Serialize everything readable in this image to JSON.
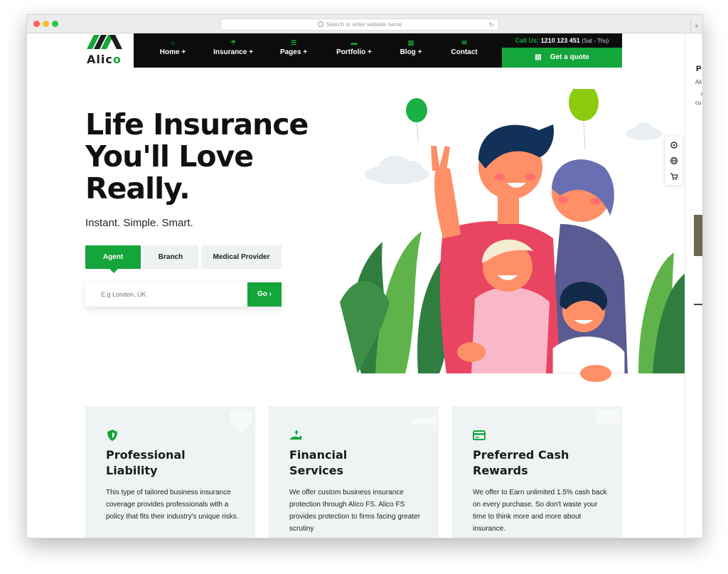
{
  "browser": {
    "address_placeholder": "Search or enter website name",
    "colors": {
      "close": "#ff5f57",
      "minimize": "#febc2e",
      "maximize": "#28c840"
    }
  },
  "brand": {
    "name_main": "Alic",
    "name_accent": "o",
    "accent_color": "#14a53b"
  },
  "nav": {
    "items": [
      {
        "label": "Home +",
        "icon": "home-icon"
      },
      {
        "label": "Insurance +",
        "icon": "umbrella-icon"
      },
      {
        "label": "Pages +",
        "icon": "menu-icon"
      },
      {
        "label": "Portfolio +",
        "icon": "briefcase-icon"
      },
      {
        "label": "Blog +",
        "icon": "document-icon"
      },
      {
        "label": "Contact",
        "icon": "envelope-icon"
      }
    ],
    "call_label": "Call Us:",
    "call_number": "1210 123 451",
    "call_hours": "(Sat - Thu)",
    "quote_label": "Get a quote"
  },
  "hero": {
    "title": "Life Insurance\nYou'll Love\nReally.",
    "subtitle": "Instant. Simple. Smart.",
    "tabs": [
      "Agent",
      "Branch",
      "Medical Provider"
    ],
    "active_tab": "Agent",
    "search_placeholder": "E.g London, UK",
    "go_label": "Go ›"
  },
  "side_tools": [
    "gear-icon",
    "globe-icon",
    "cart-icon"
  ],
  "right_panel": {
    "heading": "P",
    "lines": [
      "Ali",
      "r",
      "cu"
    ]
  },
  "cards": [
    {
      "icon": "shield-icon",
      "title": "Professional\nLiability",
      "text": "This type of tailored business insurance coverage provides professionals with a policy that fits their industry's unique risks."
    },
    {
      "icon": "hand-money-icon",
      "title": "Financial\nServices",
      "text": "We offer custom business insurance protection through Alico FS. Alico FS provides protection to firms facing greater scrutiny"
    },
    {
      "icon": "credit-card-icon",
      "title": "Preferred Cash\nRewards",
      "text": "We offer to Earn unlimited 1.5% cash back on every purchase. So don't waste your time to think more and more about insurance."
    }
  ]
}
